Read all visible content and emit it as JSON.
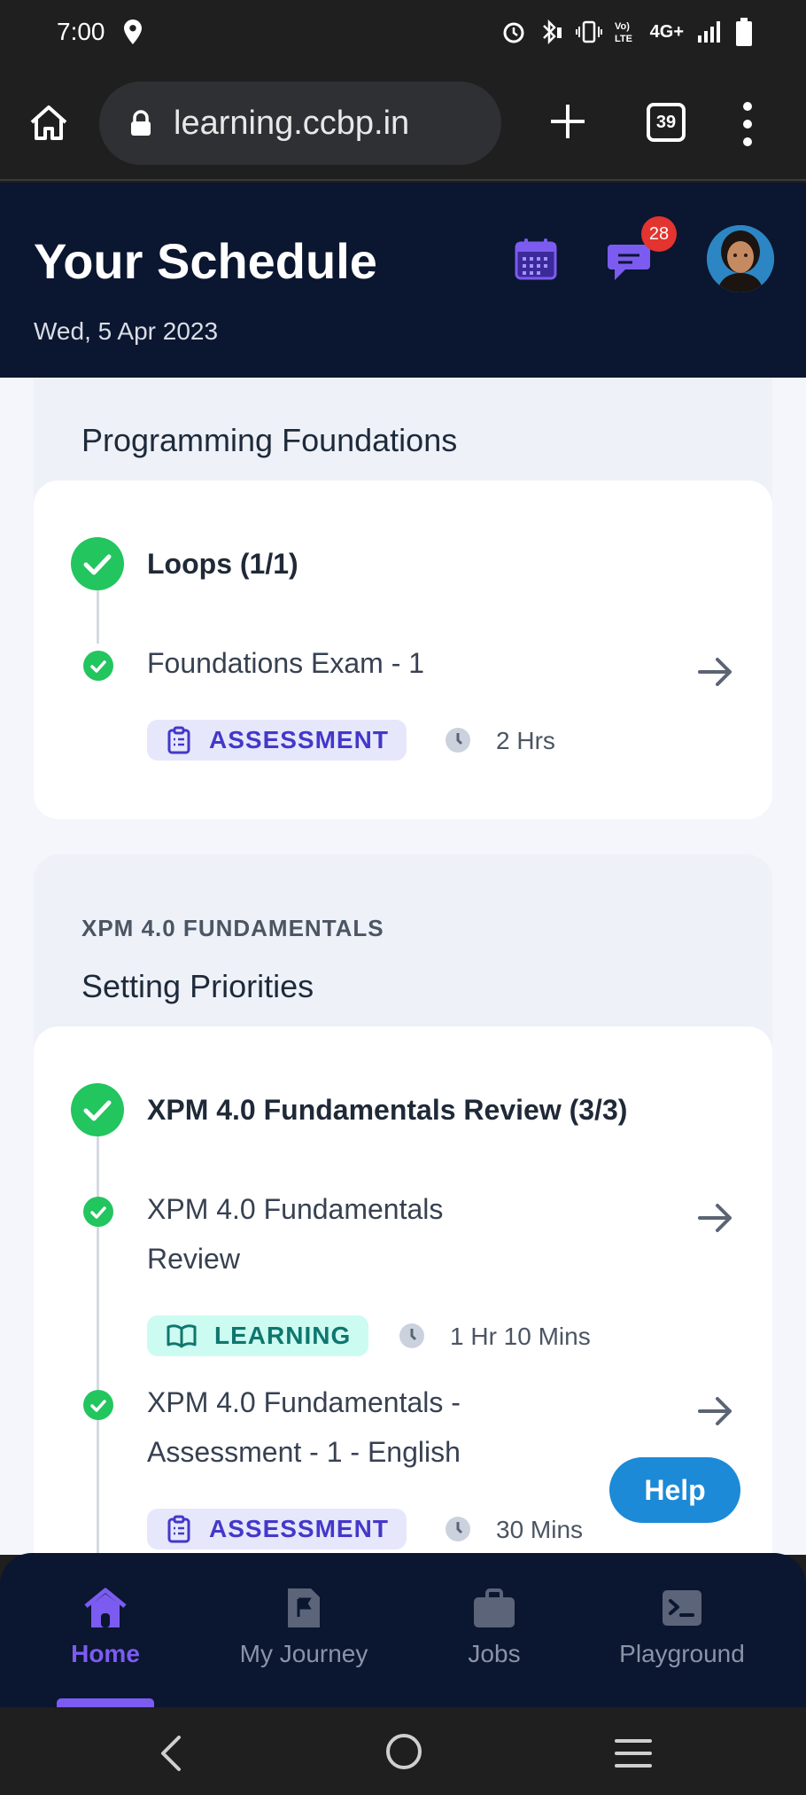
{
  "status_bar": {
    "time": "7:00",
    "network": "4G+"
  },
  "browser": {
    "url": "learning.ccbp.in",
    "tab_count": "39"
  },
  "header": {
    "title": "Your Schedule",
    "date": "Wed, 5 Apr 2023",
    "notification_count": "28"
  },
  "groups": [
    {
      "title": "Programming Foundations",
      "module": {
        "title": "Loops (1/1)",
        "items": [
          {
            "title": "Foundations Exam - 1",
            "tag": "ASSESSMENT",
            "duration": "2 Hrs"
          }
        ]
      }
    },
    {
      "kicker": "XPM 4.0 FUNDAMENTALS",
      "title": "Setting Priorities",
      "module": {
        "title": "XPM 4.0 Fundamentals Review (3/3)",
        "items": [
          {
            "title_line1": "XPM 4.0 Fundamentals",
            "title_line2": "Review",
            "tag": "LEARNING",
            "duration": "1 Hr 10 Mins"
          },
          {
            "title_line1": "XPM 4.0 Fundamentals -",
            "title_line2": "Assessment - 1 - English",
            "tag": "ASSESSMENT",
            "duration": "30 Mins"
          }
        ]
      }
    }
  ],
  "help_label": "Help",
  "bottom_nav": [
    {
      "label": "Home",
      "active": true
    },
    {
      "label": "My Journey",
      "active": false
    },
    {
      "label": "Jobs",
      "active": false
    },
    {
      "label": "Playground",
      "active": false
    }
  ],
  "colors": {
    "header_bg": "#0b1630",
    "accent": "#7c5cf0",
    "success": "#22c55e",
    "help": "#1c8ad6",
    "badge": "#e3342f"
  }
}
